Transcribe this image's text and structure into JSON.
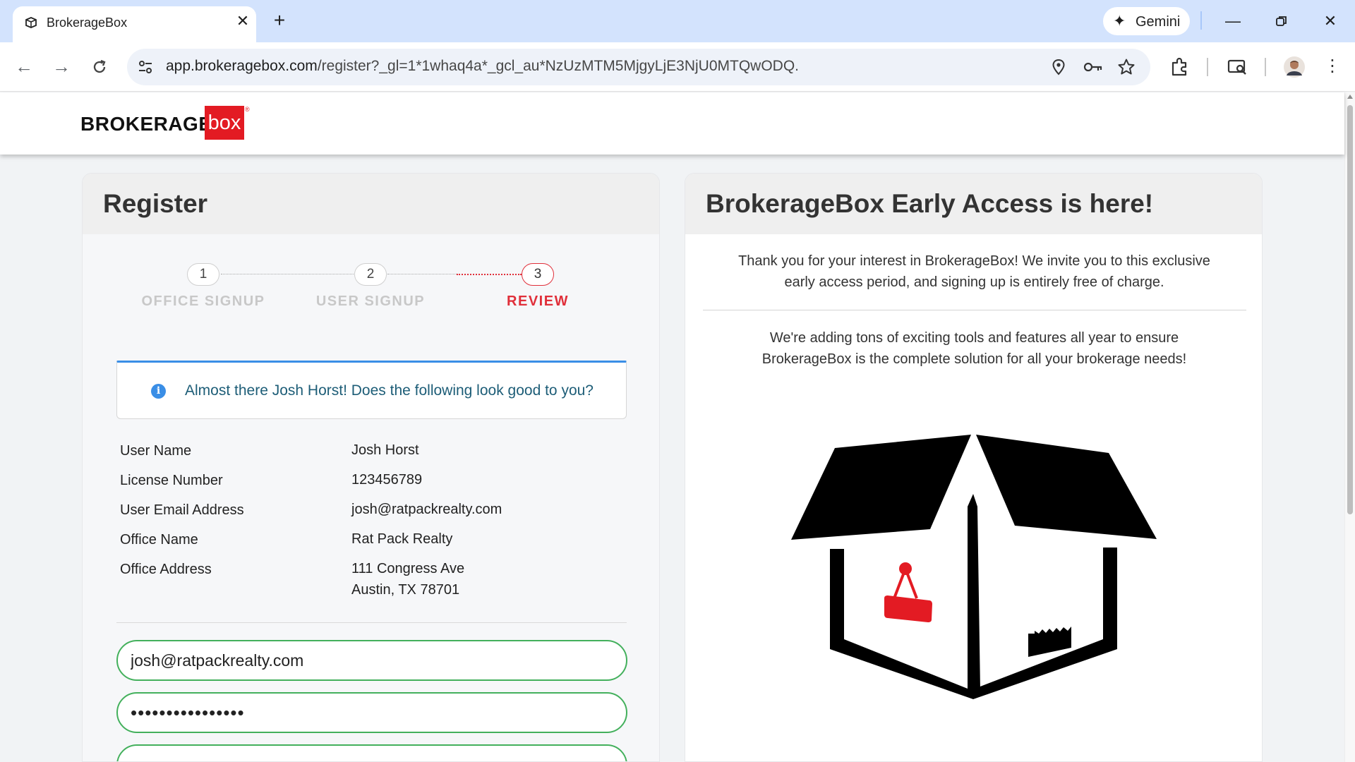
{
  "browser": {
    "tab_title": "BrokerageBox",
    "new_tab": "+",
    "gemini_label": "Gemini",
    "url_host": "app.brokeragebox.com",
    "url_rest": "/register?_gl=1*1whaq4a*_gcl_au*NzUzMTM5MjgyLjE3NjU0MTQwODQ."
  },
  "site": {
    "logo_word": "BROKERAGE",
    "logo_box": "box",
    "logo_reg": "®"
  },
  "register": {
    "title": "Register",
    "steps": [
      {
        "number": "1",
        "label": "OFFICE SIGNUP"
      },
      {
        "number": "2",
        "label": "USER SIGNUP"
      },
      {
        "number": "3",
        "label": "REVIEW"
      }
    ],
    "alert_icon": "i",
    "alert": "Almost there Josh Horst! Does the following look good to you?",
    "summary": [
      {
        "label": "User Name",
        "value": "Josh Horst"
      },
      {
        "label": "License Number",
        "value": "123456789"
      },
      {
        "label": "User Email Address",
        "value": "josh@ratpackrealty.com"
      },
      {
        "label": "Office Name",
        "value": "Rat Pack Realty"
      },
      {
        "label": "Office Address",
        "value": "111 Congress Ave",
        "value2": "Austin, TX 78701"
      }
    ],
    "email_value": "josh@ratpackrealty.com",
    "password_value": "••••••••••••••••"
  },
  "promo": {
    "title": "BrokerageBox Early Access is here!",
    "paragraph1_line1": "Thank you for your interest in BrokerageBox! We invite you to this exclusive",
    "paragraph1_line2": "early access period, and signing up is entirely free of charge.",
    "paragraph2_line1": "We're adding tons of exciting tools and features all year to ensure",
    "paragraph2_line2": "BrokerageBox is the complete solution for all your brokerage needs!"
  },
  "colors": {
    "accent_red": "#e02f3a",
    "field_green": "#43b05c",
    "info_blue": "#3a8ee6",
    "chrome_blue": "#d3e3fd"
  },
  "icons": [
    "favicon-icon",
    "close-icon",
    "plus-icon",
    "sparkle-icon",
    "minimize-icon",
    "restore-icon",
    "back-icon",
    "forward-icon",
    "reload-icon",
    "site-info-icon",
    "location-icon",
    "key-icon",
    "star-icon",
    "extensions-icon",
    "cast-icon",
    "avatar",
    "menu-icon",
    "info-icon"
  ]
}
